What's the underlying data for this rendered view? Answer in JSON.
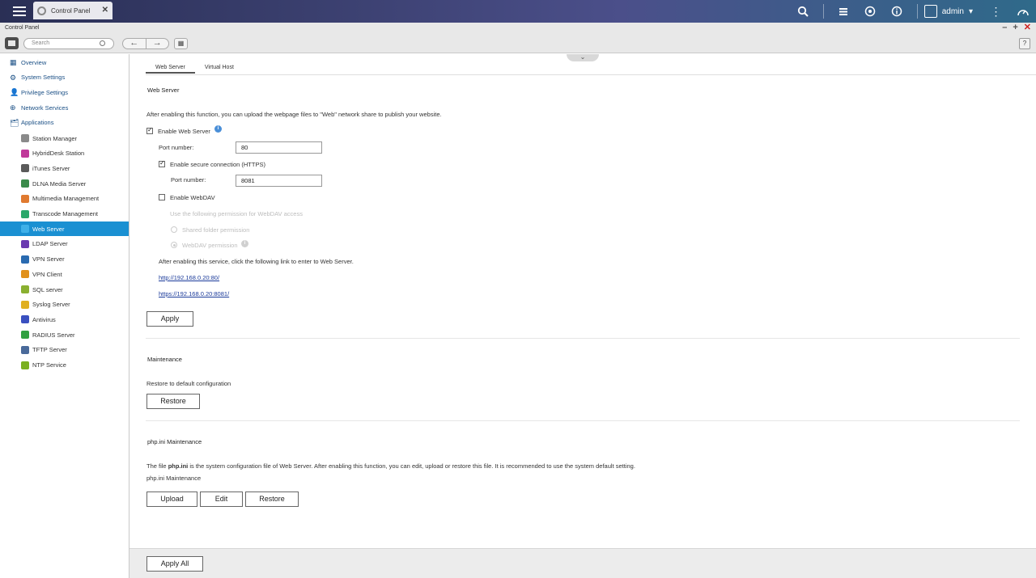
{
  "topbar": {
    "app_tab_label": "Control Panel",
    "username": "admin"
  },
  "window": {
    "title": "Control Panel",
    "search_placeholder": "Search"
  },
  "sidebar": {
    "top_items": [
      {
        "label": "Overview"
      },
      {
        "label": "System Settings"
      },
      {
        "label": "Privilege Settings"
      },
      {
        "label": "Network Services"
      },
      {
        "label": "Applications"
      }
    ],
    "app_items": [
      {
        "label": "Station Manager",
        "color": "#8a8a8a"
      },
      {
        "label": "HybridDesk Station",
        "color": "#c0399a"
      },
      {
        "label": "iTunes Server",
        "color": "#5a5a5a"
      },
      {
        "label": "DLNA Media Server",
        "color": "#3a8a4a"
      },
      {
        "label": "Multimedia Management",
        "color": "#e07a30"
      },
      {
        "label": "Transcode Management",
        "color": "#2aa86a"
      },
      {
        "label": "Web Server",
        "color": "#3fb0e8"
      },
      {
        "label": "LDAP Server",
        "color": "#6a3ab0"
      },
      {
        "label": "VPN Server",
        "color": "#2a6ab0"
      },
      {
        "label": "VPN Client",
        "color": "#e0901a"
      },
      {
        "label": "SQL server",
        "color": "#8ab030"
      },
      {
        "label": "Syslog Server",
        "color": "#e0b020"
      },
      {
        "label": "Antivirus",
        "color": "#3a50c0"
      },
      {
        "label": "RADIUS Server",
        "color": "#30a040"
      },
      {
        "label": "TFTP Server",
        "color": "#4a6a9a"
      },
      {
        "label": "NTP Service",
        "color": "#7ab020"
      }
    ],
    "active_index": 6
  },
  "tabs": [
    "Web Server",
    "Virtual Host"
  ],
  "web_server": {
    "heading": "Web Server",
    "description": "After enabling this function, you can upload the webpage files to \"Web\" network share to publish your website.",
    "enable_label": "Enable Web Server",
    "enable_checked": true,
    "port_label": "Port number:",
    "port_value": "80",
    "https_label": "Enable secure connection (HTTPS)",
    "https_checked": true,
    "https_port_label": "Port number:",
    "https_port_value": "8081",
    "webdav_label": "Enable WebDAV",
    "webdav_checked": false,
    "webdav_perm_heading": "Use the following permission for WebDAV access",
    "webdav_opt1": "Shared folder permission",
    "webdav_opt2": "WebDAV permission",
    "link_intro": "After enabling this service, click the following link to enter to Web Server.",
    "link_http": "http://192.168.0.20:80/",
    "link_https": "https://192.168.0.20:8081/",
    "apply_label": "Apply"
  },
  "maintenance": {
    "heading": "Maintenance",
    "restore_text": "Restore to default configuration",
    "restore_label": "Restore"
  },
  "php": {
    "heading": "php.ini Maintenance",
    "desc_prefix": "The file ",
    "desc_file": "php.ini",
    "desc_suffix": " is the system configuration file of Web Server. After enabling this function, you can edit, upload or restore this file. It is recommended to use the system default setting.",
    "sub_label": "php.ini Maintenance",
    "upload_label": "Upload",
    "edit_label": "Edit",
    "restore_label": "Restore"
  },
  "footer": {
    "apply_all_label": "Apply All"
  }
}
